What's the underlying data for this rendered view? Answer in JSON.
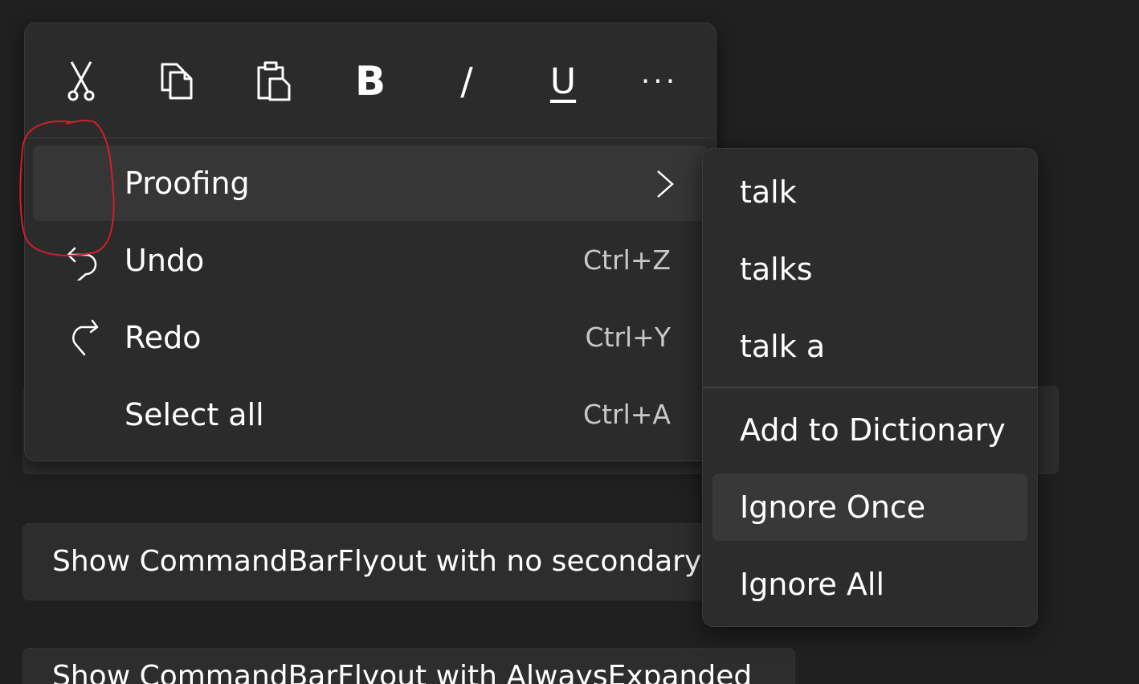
{
  "primary_commands": [
    {
      "name": "cut",
      "icon": "cut-icon"
    },
    {
      "name": "copy",
      "icon": "copy-icon"
    },
    {
      "name": "paste",
      "icon": "paste-icon"
    },
    {
      "name": "bold",
      "icon": "bold-icon",
      "glyph": "B"
    },
    {
      "name": "italic",
      "icon": "italic-icon",
      "glyph": "/"
    },
    {
      "name": "underline",
      "icon": "underline-icon",
      "glyph": "U"
    },
    {
      "name": "more",
      "icon": "more-icon",
      "glyph": "···"
    }
  ],
  "menu": {
    "proofing_label": "Proofing",
    "undo_label": "Undo",
    "undo_shortcut": "Ctrl+Z",
    "redo_label": "Redo",
    "redo_shortcut": "Ctrl+Y",
    "select_all_label": "Select all",
    "select_all_shortcut": "Ctrl+A"
  },
  "submenu": {
    "suggestions": [
      "talk",
      "talks",
      "talk a"
    ],
    "add_to_dictionary": "Add to Dictionary",
    "ignore_once": "Ignore Once",
    "ignore_all": "Ignore All"
  },
  "background": {
    "button_2_label": "Show CommandBarFlyout with no secondary commands",
    "button_3_label": "Show CommandBarFlyout with AlwaysExpanded"
  },
  "colors": {
    "background": "#202020",
    "flyout": "#2b2b2b",
    "hover": "#363636",
    "annotation": "#d21f2a"
  }
}
